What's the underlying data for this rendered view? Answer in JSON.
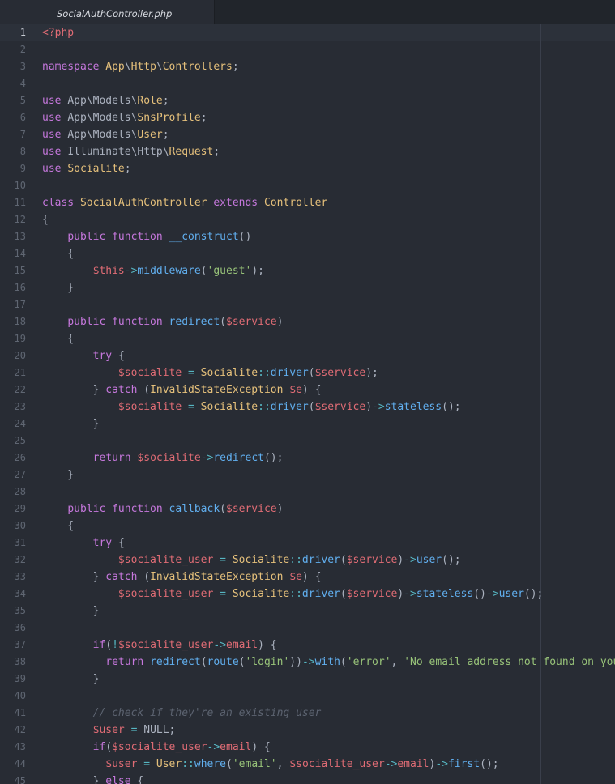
{
  "tab": {
    "filename": "SocialAuthController.php"
  },
  "editor": {
    "active_line": 1,
    "colors": {
      "background": "#282c34",
      "keyword": "#c678dd",
      "function": "#61afef",
      "class": "#e5c07b",
      "variable": "#e06c75",
      "string": "#98c379",
      "operator": "#56b6c2",
      "comment": "#5c6370"
    },
    "lines": [
      {
        "n": "1",
        "tokens": [
          [
            "tag",
            "<?php"
          ]
        ]
      },
      {
        "n": "2",
        "tokens": []
      },
      {
        "n": "3",
        "tokens": [
          [
            "kw",
            "namespace "
          ],
          [
            "cls",
            "App"
          ],
          [
            "plain",
            "\\"
          ],
          [
            "cls",
            "Http"
          ],
          [
            "plain",
            "\\"
          ],
          [
            "cls",
            "Controllers"
          ],
          [
            "plain",
            ";"
          ]
        ]
      },
      {
        "n": "4",
        "tokens": []
      },
      {
        "n": "5",
        "tokens": [
          [
            "kw",
            "use "
          ],
          [
            "plain",
            "App\\Models\\"
          ],
          [
            "cls",
            "Role"
          ],
          [
            "plain",
            ";"
          ]
        ]
      },
      {
        "n": "6",
        "tokens": [
          [
            "kw",
            "use "
          ],
          [
            "plain",
            "App\\Models\\"
          ],
          [
            "cls",
            "SnsProfile"
          ],
          [
            "plain",
            ";"
          ]
        ]
      },
      {
        "n": "7",
        "tokens": [
          [
            "kw",
            "use "
          ],
          [
            "plain",
            "App\\Models\\"
          ],
          [
            "cls",
            "User"
          ],
          [
            "plain",
            ";"
          ]
        ]
      },
      {
        "n": "8",
        "tokens": [
          [
            "kw",
            "use "
          ],
          [
            "plain",
            "Illuminate\\Http\\"
          ],
          [
            "cls",
            "Request"
          ],
          [
            "plain",
            ";"
          ]
        ]
      },
      {
        "n": "9",
        "tokens": [
          [
            "kw",
            "use "
          ],
          [
            "cls",
            "Socialite"
          ],
          [
            "plain",
            ";"
          ]
        ]
      },
      {
        "n": "10",
        "tokens": []
      },
      {
        "n": "11",
        "tokens": [
          [
            "kw",
            "class "
          ],
          [
            "cls",
            "SocialAuthController "
          ],
          [
            "kw",
            "extends "
          ],
          [
            "cls",
            "Controller"
          ]
        ]
      },
      {
        "n": "12",
        "tokens": [
          [
            "plain",
            "{"
          ]
        ]
      },
      {
        "n": "13",
        "tokens": [
          [
            "plain",
            "    "
          ],
          [
            "kw",
            "public function "
          ],
          [
            "fn",
            "__construct"
          ],
          [
            "plain",
            "()"
          ]
        ]
      },
      {
        "n": "14",
        "tokens": [
          [
            "plain",
            "    {"
          ]
        ]
      },
      {
        "n": "15",
        "tokens": [
          [
            "plain",
            "        "
          ],
          [
            "var",
            "$this"
          ],
          [
            "op",
            "->"
          ],
          [
            "fn",
            "middleware"
          ],
          [
            "plain",
            "("
          ],
          [
            "str",
            "'guest'"
          ],
          [
            "plain",
            ");"
          ]
        ]
      },
      {
        "n": "16",
        "tokens": [
          [
            "plain",
            "    }"
          ]
        ]
      },
      {
        "n": "17",
        "tokens": []
      },
      {
        "n": "18",
        "tokens": [
          [
            "plain",
            "    "
          ],
          [
            "kw",
            "public function "
          ],
          [
            "fn",
            "redirect"
          ],
          [
            "plain",
            "("
          ],
          [
            "var",
            "$service"
          ],
          [
            "plain",
            ")"
          ]
        ]
      },
      {
        "n": "19",
        "tokens": [
          [
            "plain",
            "    {"
          ]
        ]
      },
      {
        "n": "20",
        "tokens": [
          [
            "plain",
            "        "
          ],
          [
            "kw",
            "try "
          ],
          [
            "plain",
            "{"
          ]
        ]
      },
      {
        "n": "21",
        "tokens": [
          [
            "plain",
            "            "
          ],
          [
            "var",
            "$socialite "
          ],
          [
            "op",
            "= "
          ],
          [
            "cls",
            "Socialite"
          ],
          [
            "op",
            "::"
          ],
          [
            "fn",
            "driver"
          ],
          [
            "plain",
            "("
          ],
          [
            "var",
            "$service"
          ],
          [
            "plain",
            ");"
          ]
        ]
      },
      {
        "n": "22",
        "tokens": [
          [
            "plain",
            "        } "
          ],
          [
            "kw",
            "catch "
          ],
          [
            "plain",
            "("
          ],
          [
            "cls",
            "InvalidStateException "
          ],
          [
            "var",
            "$e"
          ],
          [
            "plain",
            ") {"
          ]
        ]
      },
      {
        "n": "23",
        "tokens": [
          [
            "plain",
            "            "
          ],
          [
            "var",
            "$socialite "
          ],
          [
            "op",
            "= "
          ],
          [
            "cls",
            "Socialite"
          ],
          [
            "op",
            "::"
          ],
          [
            "fn",
            "driver"
          ],
          [
            "plain",
            "("
          ],
          [
            "var",
            "$service"
          ],
          [
            "plain",
            ")"
          ],
          [
            "op",
            "->"
          ],
          [
            "fn",
            "stateless"
          ],
          [
            "plain",
            "();"
          ]
        ]
      },
      {
        "n": "24",
        "tokens": [
          [
            "plain",
            "        }"
          ]
        ]
      },
      {
        "n": "25",
        "tokens": []
      },
      {
        "n": "26",
        "tokens": [
          [
            "plain",
            "        "
          ],
          [
            "kw",
            "return "
          ],
          [
            "var",
            "$socialite"
          ],
          [
            "op",
            "->"
          ],
          [
            "fn",
            "redirect"
          ],
          [
            "plain",
            "();"
          ]
        ]
      },
      {
        "n": "27",
        "tokens": [
          [
            "plain",
            "    }"
          ]
        ]
      },
      {
        "n": "28",
        "tokens": []
      },
      {
        "n": "29",
        "tokens": [
          [
            "plain",
            "    "
          ],
          [
            "kw",
            "public function "
          ],
          [
            "fn",
            "callback"
          ],
          [
            "plain",
            "("
          ],
          [
            "var",
            "$service"
          ],
          [
            "plain",
            ")"
          ]
        ]
      },
      {
        "n": "30",
        "tokens": [
          [
            "plain",
            "    {"
          ]
        ]
      },
      {
        "n": "31",
        "tokens": [
          [
            "plain",
            "        "
          ],
          [
            "kw",
            "try "
          ],
          [
            "plain",
            "{"
          ]
        ]
      },
      {
        "n": "32",
        "tokens": [
          [
            "plain",
            "            "
          ],
          [
            "var",
            "$socialite_user "
          ],
          [
            "op",
            "= "
          ],
          [
            "cls",
            "Socialite"
          ],
          [
            "op",
            "::"
          ],
          [
            "fn",
            "driver"
          ],
          [
            "plain",
            "("
          ],
          [
            "var",
            "$service"
          ],
          [
            "plain",
            ")"
          ],
          [
            "op",
            "->"
          ],
          [
            "fn",
            "user"
          ],
          [
            "plain",
            "();"
          ]
        ]
      },
      {
        "n": "33",
        "tokens": [
          [
            "plain",
            "        } "
          ],
          [
            "kw",
            "catch "
          ],
          [
            "plain",
            "("
          ],
          [
            "cls",
            "InvalidStateException "
          ],
          [
            "var",
            "$e"
          ],
          [
            "plain",
            ") {"
          ]
        ]
      },
      {
        "n": "34",
        "tokens": [
          [
            "plain",
            "            "
          ],
          [
            "var",
            "$socialite_user "
          ],
          [
            "op",
            "= "
          ],
          [
            "cls",
            "Socialite"
          ],
          [
            "op",
            "::"
          ],
          [
            "fn",
            "driver"
          ],
          [
            "plain",
            "("
          ],
          [
            "var",
            "$service"
          ],
          [
            "plain",
            ")"
          ],
          [
            "op",
            "->"
          ],
          [
            "fn",
            "stateless"
          ],
          [
            "plain",
            "()"
          ],
          [
            "op",
            "->"
          ],
          [
            "fn",
            "user"
          ],
          [
            "plain",
            "();"
          ]
        ]
      },
      {
        "n": "35",
        "tokens": [
          [
            "plain",
            "        }"
          ]
        ]
      },
      {
        "n": "36",
        "tokens": []
      },
      {
        "n": "37",
        "tokens": [
          [
            "plain",
            "        "
          ],
          [
            "kw",
            "if"
          ],
          [
            "plain",
            "("
          ],
          [
            "op",
            "!"
          ],
          [
            "var",
            "$socialite_user"
          ],
          [
            "op",
            "->"
          ],
          [
            "var",
            "email"
          ],
          [
            "plain",
            ") {"
          ]
        ]
      },
      {
        "n": "38",
        "tokens": [
          [
            "plain",
            "          "
          ],
          [
            "kw",
            "return "
          ],
          [
            "fn",
            "redirect"
          ],
          [
            "plain",
            "("
          ],
          [
            "fn",
            "route"
          ],
          [
            "plain",
            "("
          ],
          [
            "str",
            "'login'"
          ],
          [
            "plain",
            "))"
          ],
          [
            "op",
            "->"
          ],
          [
            "fn",
            "with"
          ],
          [
            "plain",
            "("
          ],
          [
            "str",
            "'error'"
          ],
          [
            "plain",
            ", "
          ],
          [
            "str",
            "'No email address not found on your"
          ]
        ]
      },
      {
        "n": "39",
        "tokens": [
          [
            "plain",
            "        }"
          ]
        ]
      },
      {
        "n": "40",
        "tokens": []
      },
      {
        "n": "41",
        "tokens": [
          [
            "plain",
            "        "
          ],
          [
            "cmt",
            "// check if they're an existing user"
          ]
        ]
      },
      {
        "n": "42",
        "tokens": [
          [
            "plain",
            "        "
          ],
          [
            "var",
            "$user "
          ],
          [
            "op",
            "= "
          ],
          [
            "plain",
            "NULL;"
          ]
        ]
      },
      {
        "n": "43",
        "tokens": [
          [
            "plain",
            "        "
          ],
          [
            "kw",
            "if"
          ],
          [
            "plain",
            "("
          ],
          [
            "var",
            "$socialite_user"
          ],
          [
            "op",
            "->"
          ],
          [
            "var",
            "email"
          ],
          [
            "plain",
            ") {"
          ]
        ]
      },
      {
        "n": "44",
        "tokens": [
          [
            "plain",
            "          "
          ],
          [
            "var",
            "$user "
          ],
          [
            "op",
            "= "
          ],
          [
            "cls",
            "User"
          ],
          [
            "op",
            "::"
          ],
          [
            "fn",
            "where"
          ],
          [
            "plain",
            "("
          ],
          [
            "str",
            "'email'"
          ],
          [
            "plain",
            ", "
          ],
          [
            "var",
            "$socialite_user"
          ],
          [
            "op",
            "->"
          ],
          [
            "var",
            "email"
          ],
          [
            "plain",
            ")"
          ],
          [
            "op",
            "->"
          ],
          [
            "fn",
            "first"
          ],
          [
            "plain",
            "();"
          ]
        ]
      },
      {
        "n": "45",
        "tokens": [
          [
            "plain",
            "        } "
          ],
          [
            "kw",
            "else "
          ],
          [
            "plain",
            "{"
          ]
        ]
      }
    ]
  }
}
